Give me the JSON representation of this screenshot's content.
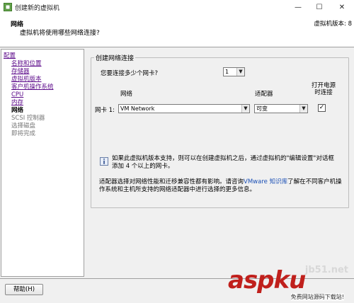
{
  "window": {
    "title": "创建新的虚拟机",
    "minimize": "—",
    "maximize": "☐",
    "close": "✕"
  },
  "header": {
    "title": "网络",
    "subtitle": "虚拟机将使用哪些网络连接?",
    "version": "虚拟机版本: 8"
  },
  "sidebar": {
    "items": [
      {
        "label": "配置",
        "state": "link"
      },
      {
        "label": "名称和位置",
        "state": "link"
      },
      {
        "label": "存储器",
        "state": "link"
      },
      {
        "label": "虚拟机版本",
        "state": "link"
      },
      {
        "label": "客户机操作系统",
        "state": "link"
      },
      {
        "label": "CPU",
        "state": "link"
      },
      {
        "label": "内存",
        "state": "link"
      },
      {
        "label": "网络",
        "state": "current"
      },
      {
        "label": "SCSI 控制器",
        "state": "disabled"
      },
      {
        "label": "选择磁盘",
        "state": "disabled"
      },
      {
        "label": "即将完成",
        "state": "disabled"
      }
    ]
  },
  "group": {
    "legend": "创建网络连接",
    "nic_question": "您要连接多少个网卡?",
    "nic_count": "1",
    "col_network": "网络",
    "col_adapter": "适配器",
    "col_power_on": "打开电源时连接",
    "nic_row": {
      "label": "网卡 1:",
      "network": "VM Network",
      "adapter": "可变",
      "connect_at_power_on": true
    },
    "info_text": "如果此虚拟机版本支持，则可以在创建虚拟机之后，通过虚拟机的\"编辑设置\"对话框添加 4 个以上的网卡。",
    "adapter_text_before": "适配器选择对网络性能和迁移兼容性都有影响。请咨询",
    "adapter_link": "VMware 知识库",
    "adapter_text_after": "了解在不同客户机操作系统和主机所支持的网络适配器中进行选择的更多信息。"
  },
  "footer": {
    "help_label": "帮助(H)"
  },
  "watermark": {
    "brand": "aspku",
    "net": "jb51.net",
    "tagline": "免费网站源码下载站!"
  },
  "colors": {
    "link": "#5c0a8a",
    "vmware_link": "#1a4fb5",
    "watermark_red": "#c0201c"
  }
}
